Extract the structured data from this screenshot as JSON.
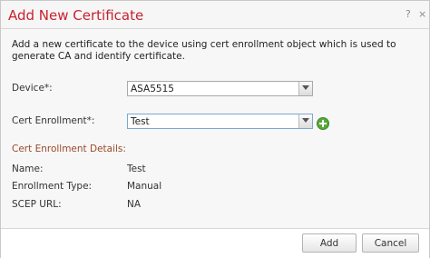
{
  "dialog": {
    "title": "Add New Certificate",
    "help_glyph": "?",
    "close_glyph": "×"
  },
  "description": "Add a new certificate to the device using cert enrollment object which is used to generate CA and identify certificate.",
  "form": {
    "device_label": "Device*:",
    "device_value": "ASA5515",
    "cert_enrollment_label": "Cert Enrollment*:",
    "cert_enrollment_value": "Test"
  },
  "details": {
    "section_title": "Cert Enrollment Details:",
    "name_label": "Name:",
    "name_value": "Test",
    "enrollment_type_label": "Enrollment Type:",
    "enrollment_type_value": "Manual",
    "scep_url_label": "SCEP URL:",
    "scep_url_value": "NA"
  },
  "footer": {
    "add_label": "Add",
    "cancel_label": "Cancel"
  },
  "colors": {
    "title": "#c8212f",
    "section_title": "#9a4a2a",
    "add_icon": "#5aa83a"
  }
}
